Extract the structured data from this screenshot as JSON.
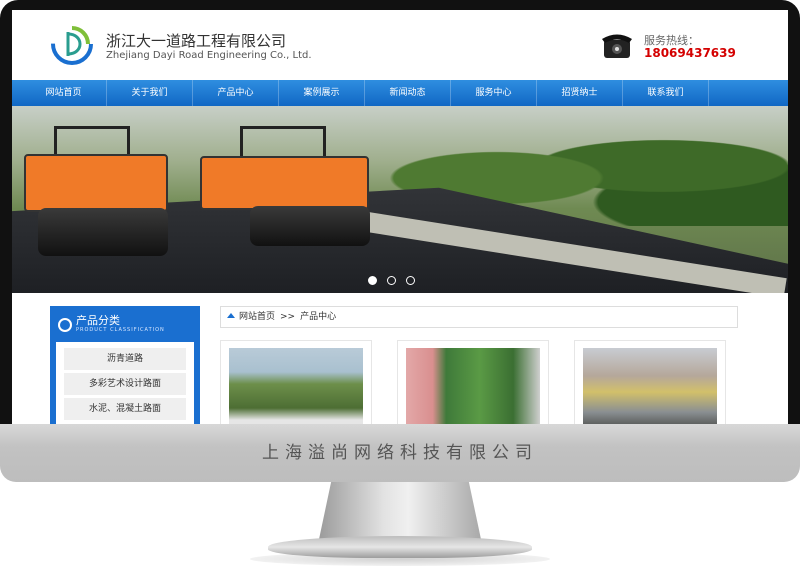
{
  "header": {
    "company_cn": "浙江大一道路工程有限公司",
    "company_en": "Zhejiang Dayi Road Engineering Co., Ltd.",
    "hotline_label": "服务热线：",
    "hotline_number": "18069437639"
  },
  "nav": {
    "items": [
      "网站首页",
      "关于我们",
      "产品中心",
      "案例展示",
      "新闻动态",
      "服务中心",
      "招贤纳士",
      "联系我们"
    ]
  },
  "banner": {
    "slides_total": 3,
    "active_slide": 1
  },
  "sidebar": {
    "title": "产品分类",
    "subtitle": "PRODUCT CLASSIFICATION",
    "items": [
      "沥青道路",
      "多彩艺术设计路面",
      "水泥、混凝土路面"
    ]
  },
  "breadcrumb": {
    "home": "网站首页",
    "separator": ">>",
    "current": "产品中心"
  },
  "footer": {
    "watermark": "上海溢尚网络科技有限公司"
  },
  "colors": {
    "nav_blue": "#1a6fd0",
    "hotline_red": "#d40000"
  }
}
